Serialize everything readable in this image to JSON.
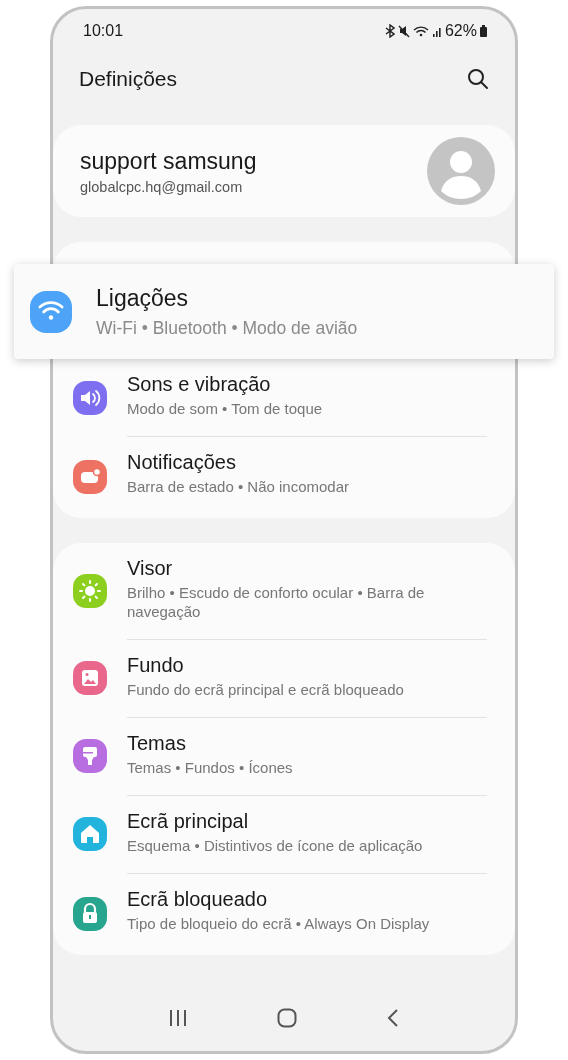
{
  "status_bar": {
    "time": "10:01",
    "battery": "62%"
  },
  "header": {
    "title": "Definições"
  },
  "profile": {
    "name": "support samsung",
    "email": "globalcpc.hq@gmail.com"
  },
  "groups": [
    {
      "items": [
        {
          "kind": "callout",
          "color": "#4da3f7",
          "title": "Ligações",
          "subtitle": "Wi-Fi • Bluetooth • Modo de avião"
        },
        {
          "kind": "row",
          "color": "#7d6ff0",
          "title": "Sons e vibração",
          "subtitle": "Modo de som • Tom de toque"
        },
        {
          "kind": "row",
          "color": "#ee7263",
          "title": "Notificações",
          "subtitle": "Barra de estado • Não incomodar"
        }
      ]
    },
    {
      "items": [
        {
          "kind": "row",
          "color": "#8ccf1e",
          "title": "Visor",
          "subtitle": "Brilho • Escudo de conforto ocular • Barra de navegação"
        },
        {
          "kind": "row",
          "color": "#e8678b",
          "title": "Fundo",
          "subtitle": "Fundo do ecrã principal e ecrã bloqueado"
        },
        {
          "kind": "row",
          "color": "#b86de0",
          "title": "Temas",
          "subtitle": "Temas • Fundos • Ícones"
        },
        {
          "kind": "row",
          "color": "#22b4dc",
          "title": "Ecrã principal",
          "subtitle": "Esquema • Distintivos de ícone de aplicação"
        },
        {
          "kind": "row",
          "color": "#27a58e",
          "title": "Ecrã bloqueado",
          "subtitle": "Tipo de bloqueio do ecrã • Always On Display"
        }
      ]
    }
  ]
}
